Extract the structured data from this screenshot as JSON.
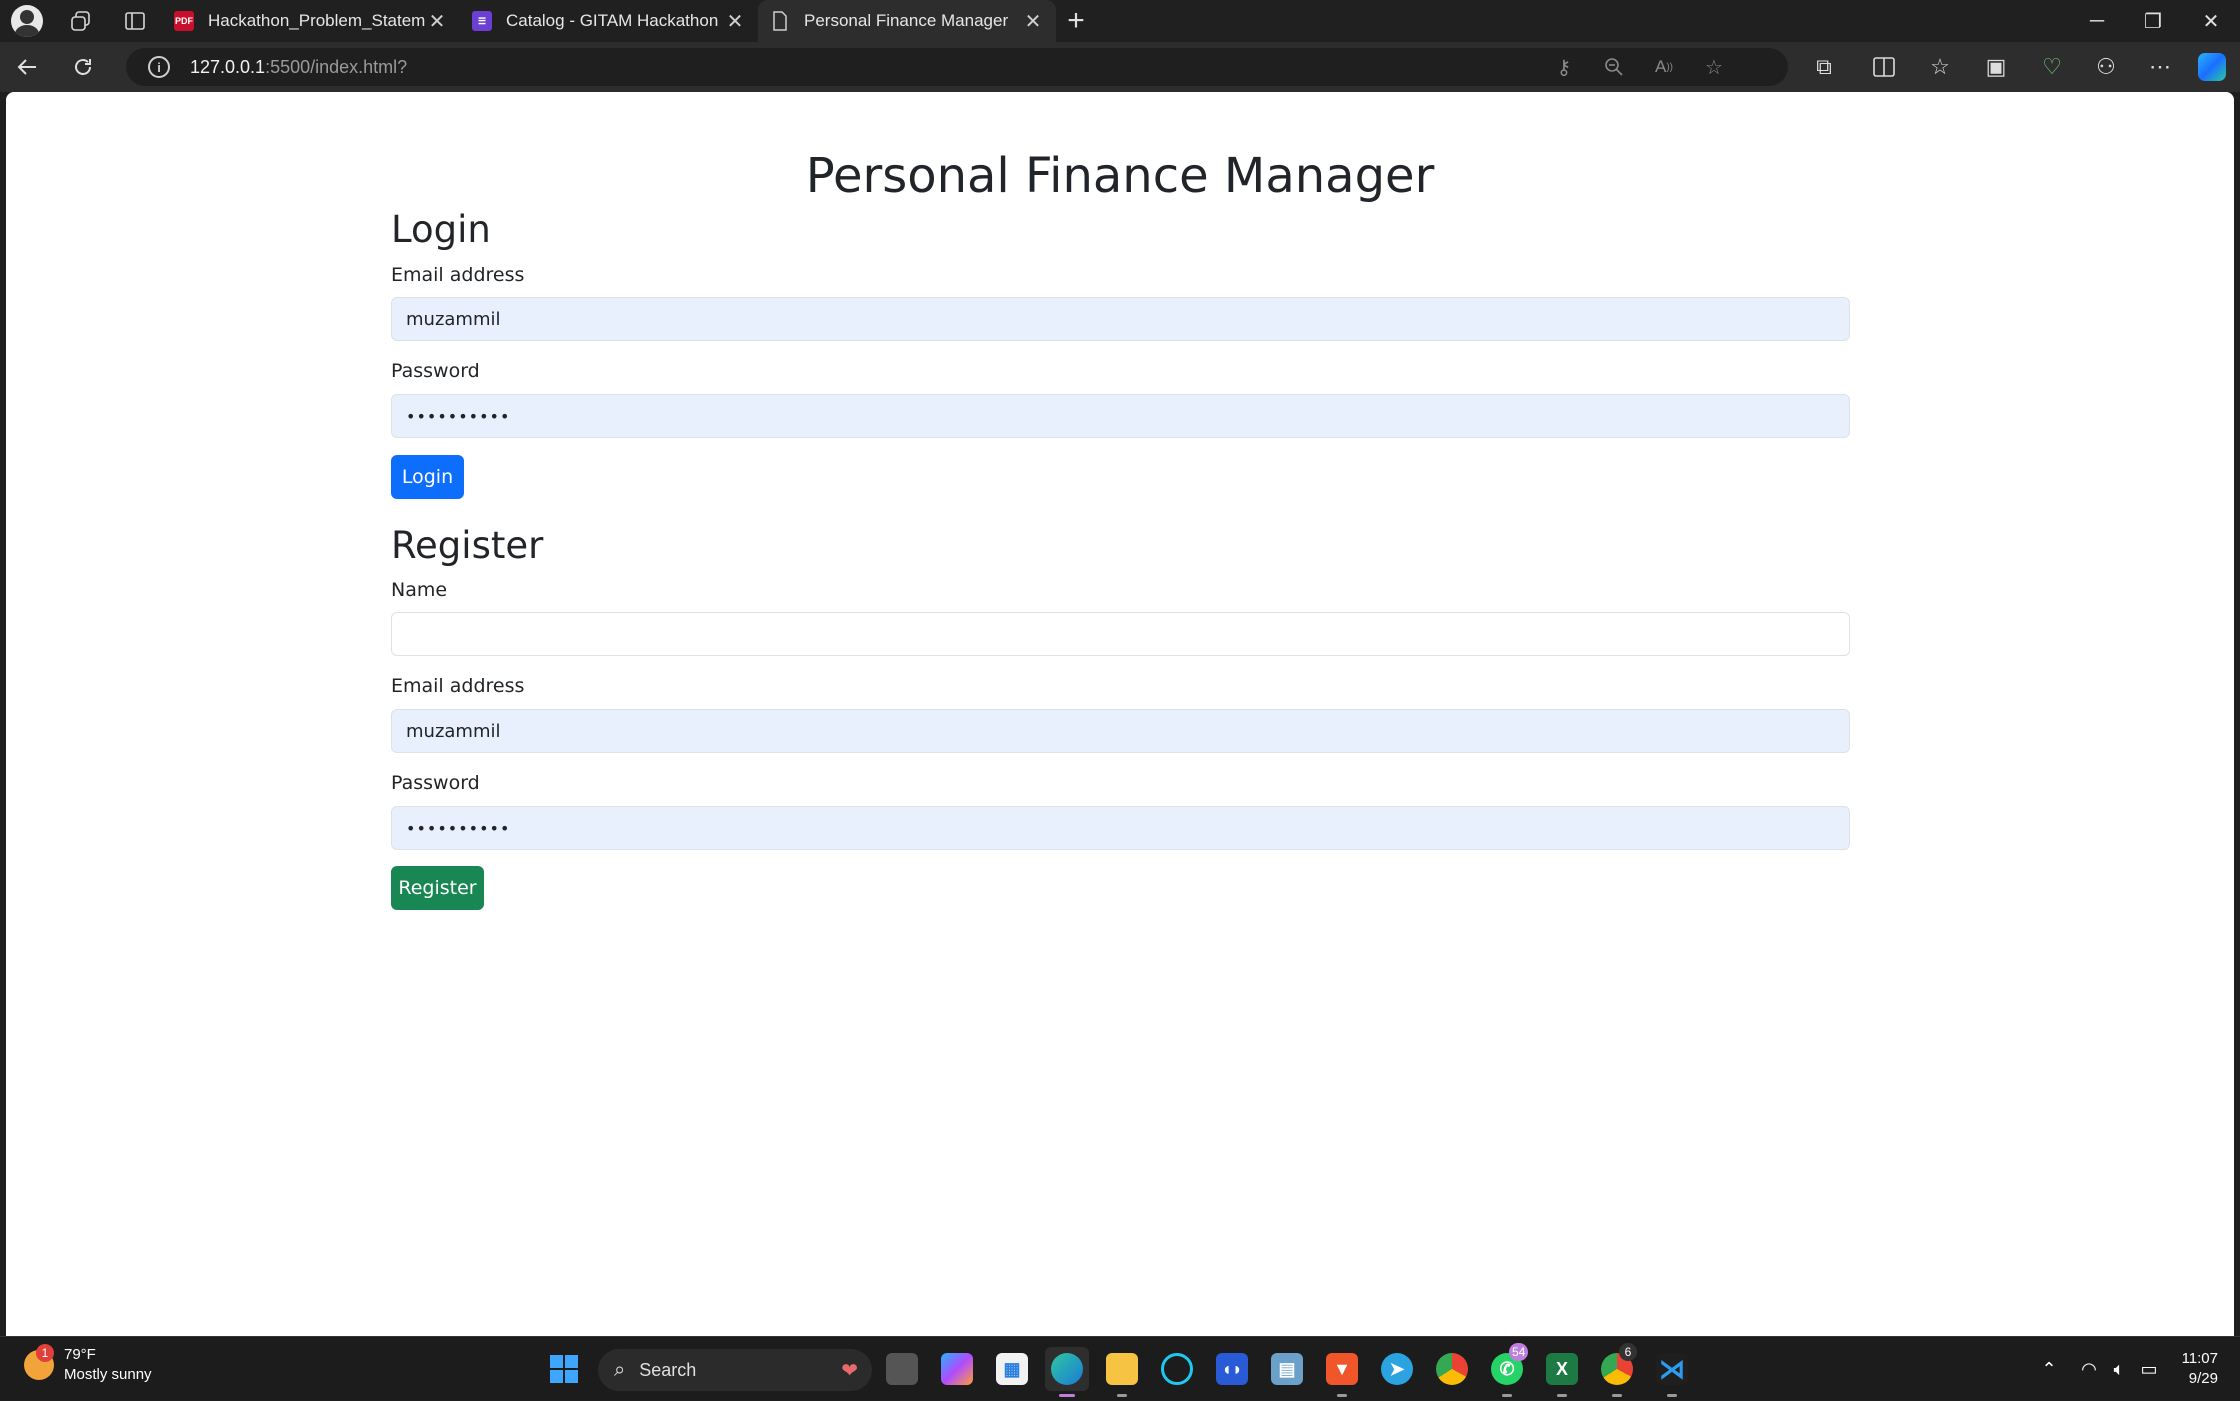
{
  "browser": {
    "tabs": [
      {
        "label": "Hackathon_Problem_Statements_",
        "favicon": "pdf-icon",
        "color": "#c8102e"
      },
      {
        "label": "Catalog - GITAM Hackathon Regis",
        "favicon": "forms-icon",
        "color": "#6b3fd1"
      },
      {
        "label": "Personal Finance Manager",
        "favicon": "page-icon",
        "color": "#cfcfcf"
      }
    ],
    "url_host": "127.0.0.1",
    "url_rest": ":5500/index.html?"
  },
  "page": {
    "title": "Personal Finance Manager",
    "login": {
      "heading": "Login",
      "email_label": "Email address",
      "email_value": "muzammil",
      "password_label": "Password",
      "password_value": "••••••••••",
      "button": "Login"
    },
    "register": {
      "heading": "Register",
      "name_label": "Name",
      "name_value": "",
      "email_label": "Email address",
      "email_value": "muzammil",
      "password_label": "Password",
      "password_value": "••••••••••",
      "button": "Register"
    }
  },
  "taskbar": {
    "weather_temp": "79°F",
    "weather_desc": "Mostly sunny",
    "weather_badge": "1",
    "search_label": "Search",
    "whatsapp_badge": "54",
    "chrome_badge": "6",
    "time": "11:07",
    "date": "9/29"
  },
  "colors": {
    "primary": "#0d6efd",
    "success": "#198754",
    "autofill": "#e8f0fe"
  }
}
